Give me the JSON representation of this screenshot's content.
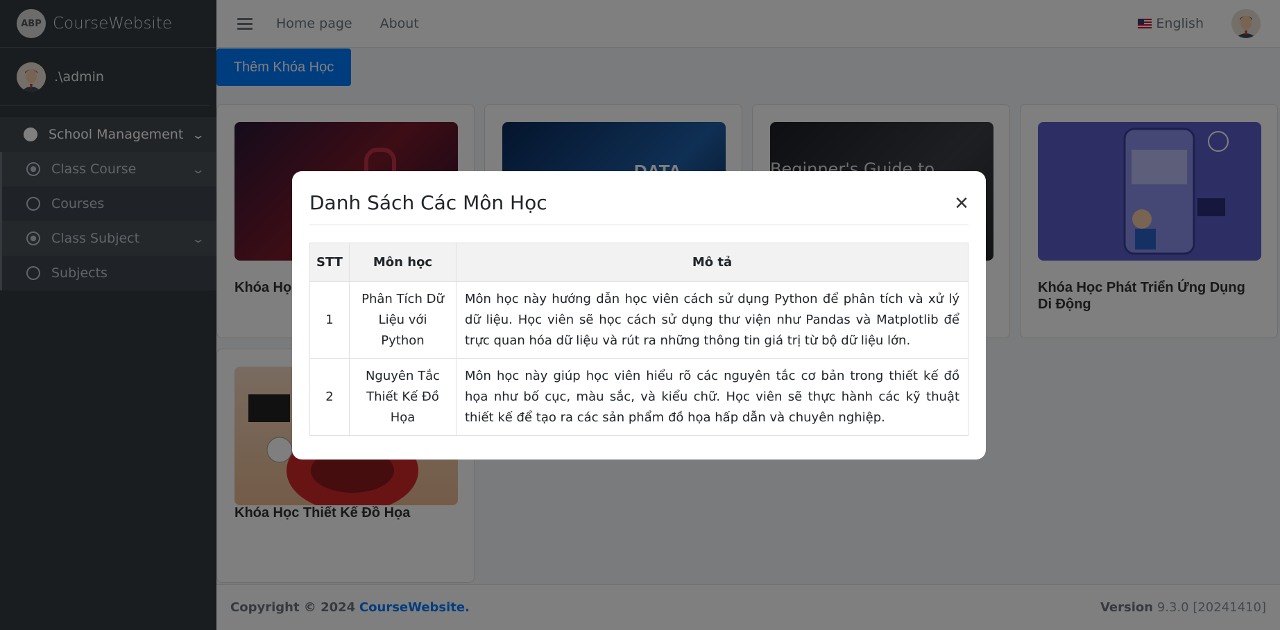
{
  "brand": {
    "name": "CourseWebsite",
    "logo_text": "ABP"
  },
  "user": {
    "name": ".\\admin"
  },
  "sidebar": {
    "items": [
      {
        "label": "School Management"
      },
      {
        "label": "Class Course"
      },
      {
        "label": "Courses"
      },
      {
        "label": "Class Subject"
      },
      {
        "label": "Subjects"
      }
    ]
  },
  "topbar": {
    "links": [
      "Home page",
      "About"
    ],
    "language": "English"
  },
  "content": {
    "add_button": "Thêm Khóa Học",
    "cards": [
      {
        "title": "Khóa Học"
      },
      {
        "title": ""
      },
      {
        "title": "",
        "image_text": "Beginner's Guide to"
      },
      {
        "title": "Khóa Học Phát Triển Ứng Dụng Di Động"
      },
      {
        "title": "Khóa Học Thiết Kế Đồ Họa"
      }
    ],
    "card2_image_text": "DATA"
  },
  "footer": {
    "copyright": "Copyright © 2024",
    "brand": "CourseWebsite.",
    "version_label": "Version",
    "version": "9.3.0 [20241410]"
  },
  "modal": {
    "title": "Danh Sách Các Môn Học",
    "close": "×",
    "headers": [
      "STT",
      "Môn học",
      "Mô tả"
    ],
    "rows": [
      {
        "stt": "1",
        "name": "Phân Tích Dữ Liệu với Python",
        "desc": "Môn học này hướng dẫn học viên cách sử dụng Python để phân tích và xử lý dữ liệu. Học viên sẽ học cách sử dụng thư viện như Pandas và Matplotlib để trực quan hóa dữ liệu và rút ra những thông tin giá trị từ bộ dữ liệu lớn."
      },
      {
        "stt": "2",
        "name": "Nguyên Tắc Thiết Kế Đồ Họa",
        "desc": "Môn học này giúp học viên hiểu rõ các nguyên tắc cơ bản trong thiết kế đồ họa như bố cục, màu sắc, và kiểu chữ. Học viên sẽ thực hành các kỹ thuật thiết kế để tạo ra các sản phẩm đồ họa hấp dẫn và chuyên nghiệp."
      }
    ]
  },
  "colors": {
    "primary": "#007bff",
    "sidebar_bg": "#343a40"
  }
}
